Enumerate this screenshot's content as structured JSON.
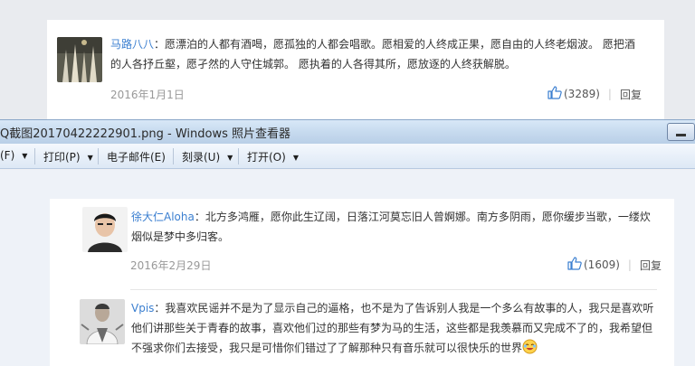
{
  "top_comment": {
    "username": "马路八八",
    "text_line1": "：愿漂泊的人都有酒喝，愿孤独的人都会唱歌。愿相爱的人终成正果，愿自由的人终老烟波。 愿把酒",
    "text_line2": "的人各抒丘壑，愿孑然的人守住城郭。 愿执着的人各得其所，愿放逐的人终获解脱。",
    "date": "2016年1月1日",
    "likes": "(3289)",
    "reply": "回复"
  },
  "viewer": {
    "title": "Q截图20170422222901.png - Windows 照片查看器",
    "menu": [
      {
        "label": "(F)"
      },
      {
        "label": "打印(P)"
      },
      {
        "label": "电子邮件(E)"
      },
      {
        "label": "刻录(U)"
      },
      {
        "label": "打开(O)"
      }
    ]
  },
  "comments": [
    {
      "username": "徐大仁Aloha",
      "text_line1": "：北方多鸿雁，愿你此生辽阔，日落江河莫忘旧人曾婀娜。南方多阴雨，愿你缓步当歌，一缕炊",
      "text_line2": "烟似是梦中多归客。",
      "date": "2016年2月29日",
      "likes": "(1609)",
      "reply": "回复"
    },
    {
      "username": "Vpis",
      "text_line1": "：我喜欢民谣并不是为了显示自己的逼格，也不是为了告诉别人我是一个多么有故事的人，我只是喜欢听",
      "text_line2": "他们讲那些关于青春的故事，喜欢他们过的那些有梦为马的生活，这些都是我羡慕而又完成不了的，我希望但",
      "text_line3": "不强求你们去接受，我只是可惜你们错过了了解那种只有音乐就可以很快乐的世界"
    }
  ],
  "colors": {
    "username": "#3b7fd0",
    "date": "#999999",
    "thumb_icon": "#3b7fd0"
  }
}
